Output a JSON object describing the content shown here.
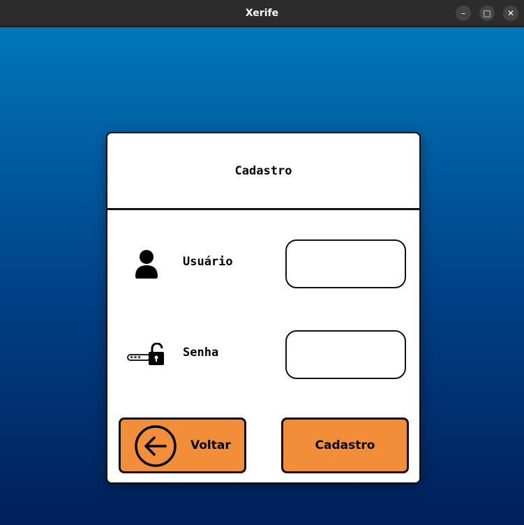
{
  "window": {
    "title": "Xerife",
    "controls": {
      "minimize": "–",
      "maximize": "□",
      "close": "✕"
    }
  },
  "form": {
    "title": "Cadastro",
    "user": {
      "label": "Usuário",
      "value": "",
      "icon": "user-icon"
    },
    "password": {
      "label": "Senha",
      "value": "",
      "icon": "password-lock-icon",
      "masked_hint": "***"
    },
    "back_button": {
      "label": "Voltar",
      "icon": "arrow-left-circle-icon"
    },
    "register_button": {
      "label": "Cadastro"
    }
  },
  "colors": {
    "background_top": "#0077b8",
    "background_bottom": "#00205a",
    "button_fill": "#f28e3a",
    "border": "#111111",
    "card": "#ffffff"
  }
}
